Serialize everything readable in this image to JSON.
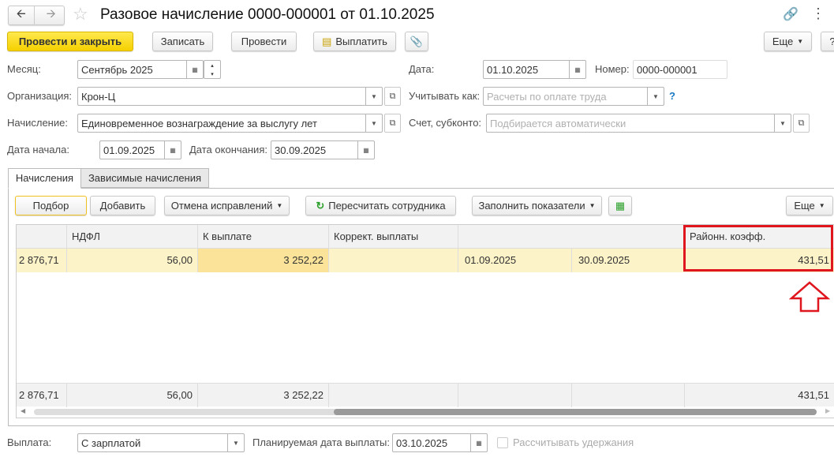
{
  "header": {
    "title": "Разовое начисление 0000-000001 от 01.10.2025"
  },
  "toolbar": {
    "post_close": "Провести и закрыть",
    "save": "Записать",
    "post": "Провести",
    "pay": "Выплатить",
    "more": "Еще",
    "help": "?"
  },
  "form": {
    "month_label": "Месяц:",
    "month": "Сентябрь 2025",
    "date_label": "Дата:",
    "date": "01.10.2025",
    "number_label": "Номер:",
    "number": "0000-000001",
    "org_label": "Организация:",
    "org": "Крон-Ц",
    "account_as_label": "Учитывать как:",
    "account_as_placeholder": "Расчеты по оплате труда",
    "help": "?",
    "accrual_label": "Начисление:",
    "accrual": "Единовременное вознаграждение за выслугу лет",
    "subconto_label": "Счет, субконто:",
    "subconto_placeholder": "Подбирается автоматически",
    "start_label": "Дата начала:",
    "start": "01.09.2025",
    "end_label": "Дата окончания:",
    "end": "30.09.2025"
  },
  "tabs": [
    "Начисления",
    "Зависимые начисления"
  ],
  "table_toolbar": {
    "select": "Подбор",
    "add": "Добавить",
    "cancel_fix": "Отмена исправлений",
    "recalc": "Пересчитать сотрудника",
    "fill": "Заполнить показатели",
    "more": "Еще"
  },
  "table": {
    "headers": [
      "",
      "НДФЛ",
      "К выплате",
      "Коррект. выплаты",
      "",
      "",
      "Районн. коэфф."
    ],
    "row": [
      "2 876,71",
      "56,00",
      "3 252,22",
      "",
      "01.09.2025",
      "30.09.2025",
      "431,51"
    ],
    "footer": [
      "2 876,71",
      "56,00",
      "3 252,22",
      "",
      "",
      "",
      "431,51"
    ]
  },
  "bottom": {
    "payment_label": "Выплата:",
    "payment": "С зарплатой",
    "planned_label": "Планируемая дата выплаты:",
    "planned": "03.10.2025",
    "withhold_label": "Рассчитывать удержания"
  }
}
